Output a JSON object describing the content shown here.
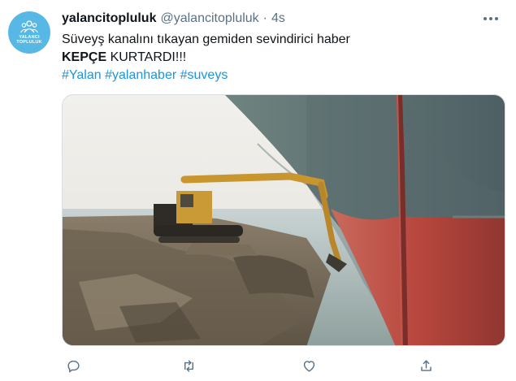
{
  "account": {
    "display_name": "yalancitopluluk",
    "handle": "@yalancitopluluk",
    "separator": "·",
    "time": "4s",
    "avatar_text_line1": "YALANCI",
    "avatar_text_line2": "TOPLULUK",
    "avatar_color": "#57b8e6"
  },
  "tweet": {
    "line1": "Süveyş kanalını tıkayan gemiden sevindirici haber",
    "line2_bold": "KEPÇE",
    "line2_rest": " KURTARDI!!!",
    "hashtags": [
      "#Yalan",
      "#yalanhaber",
      "#suveys"
    ]
  },
  "media": {
    "icon": "photo-excavator-ship"
  },
  "actions": [
    {
      "name": "reply",
      "icon": "reply-icon"
    },
    {
      "name": "retweet",
      "icon": "retweet-icon"
    },
    {
      "name": "like",
      "icon": "heart-icon"
    },
    {
      "name": "share",
      "icon": "share-icon"
    }
  ],
  "colors": {
    "link": "#1b95e0",
    "secondary_text": "#5b7083",
    "hull_red": "#b8473e"
  }
}
